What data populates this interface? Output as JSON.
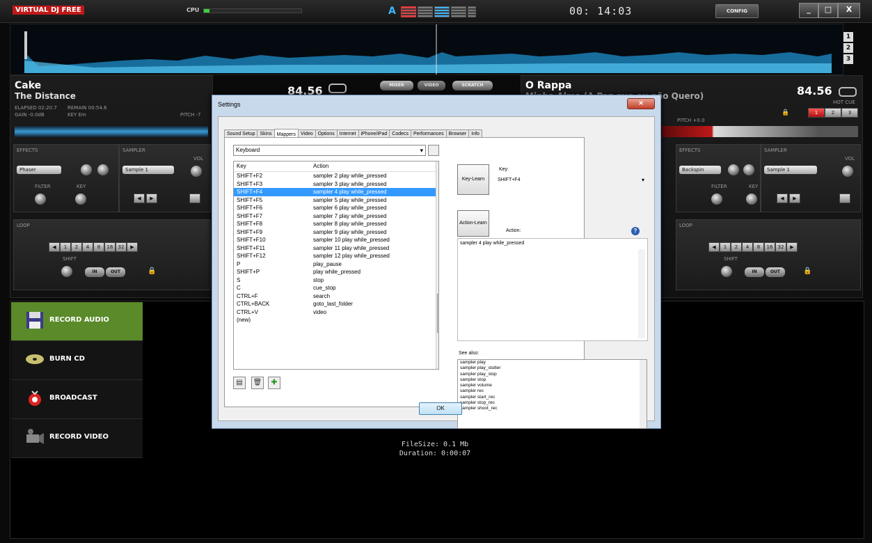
{
  "app": {
    "logo_prefix": "VIRTUAL",
    "logo_text": "DJ FREE",
    "cpu_label": "CPU",
    "cpu_level": 0.06,
    "view_a": "A",
    "clock": "00: 14:03",
    "config_label": "CONFIG",
    "window_buttons": [
      "_",
      "□",
      "X"
    ],
    "wave_buttons": [
      "1",
      "2",
      "3"
    ]
  },
  "deck_left": {
    "artist": "Cake",
    "title": "The Distance",
    "bpm": "84.56",
    "elapsed": "ELAPSED 02:20.7",
    "remain": "REMAIN 00:54.6",
    "gain": "GAIN -0.0dB",
    "key": "KEY Em",
    "pitch": "PITCH -7",
    "effects_label": "EFFECTS",
    "effect_value": "Phaser",
    "sampler_label": "SAMPLER",
    "sampler_value": "Sample 1",
    "filter_label": "FILTER",
    "key_label": "KEY",
    "vol_label": "VOL",
    "loop_label": "LOOP",
    "shift_label": "SHIFT",
    "in_label": "IN",
    "out_label": "OUT",
    "loop_values": [
      "1",
      "2",
      "4",
      "8",
      "16",
      "32"
    ]
  },
  "deck_right": {
    "artist": "O Rappa",
    "title": "Minha Alma (A Paz que eu não Quero)",
    "bpm": "84.56",
    "pitch": "PITCH +0.0",
    "hot_cue": "HOT CUE",
    "hot_cue_buttons": [
      "1",
      "2",
      "3"
    ],
    "effects_label": "EFFECTS",
    "effect_value": "Backspin",
    "sampler_label": "SAMPLER",
    "sampler_value": "Sample 1",
    "filter_label": "FILTER",
    "key_label": "KEY",
    "vol_label": "VOL",
    "loop_label": "LOOP",
    "shift_label": "SHIFT",
    "in_label": "IN",
    "out_label": "OUT",
    "loop_values": [
      "1",
      "2",
      "4",
      "8",
      "16",
      "32"
    ]
  },
  "center_tabs": [
    "MIXER",
    "VIDEO",
    "SCRATCH"
  ],
  "record_panel": {
    "items": [
      {
        "label": "RECORD AUDIO",
        "icon": "floppy-disk-icon"
      },
      {
        "label": "BURN CD",
        "icon": "cd-disc-icon"
      },
      {
        "label": "BROADCAST",
        "icon": "broadcast-icon"
      },
      {
        "label": "RECORD VIDEO",
        "icon": "video-camera-icon"
      }
    ],
    "file_size": "FileSize: 0.1 Mb",
    "duration": "Duration: 0:00:07"
  },
  "dialog": {
    "title": "Settings",
    "tabs": [
      "Sound Setup",
      "Skins",
      "Mappers",
      "Video",
      "Options",
      "Internet",
      "iPhone/iPad",
      "Codecs",
      "Performances",
      "Browser",
      "Info"
    ],
    "active_tab": "Mappers",
    "device_select": "Keyboard",
    "col_key": "Key",
    "col_action": "Action",
    "rows": [
      {
        "key": "SHIFT+F2",
        "action": "sampler 2 play while_pressed"
      },
      {
        "key": "SHIFT+F3",
        "action": "sampler 3 play while_pressed"
      },
      {
        "key": "SHIFT+F4",
        "action": "sampler 4 play while_pressed"
      },
      {
        "key": "SHIFT+F5",
        "action": "sampler 5 play while_pressed"
      },
      {
        "key": "SHIFT+F6",
        "action": "sampler 6 play while_pressed"
      },
      {
        "key": "SHIFT+F7",
        "action": "sampler 7 play while_pressed"
      },
      {
        "key": "SHIFT+F8",
        "action": "sampler 8 play while_pressed"
      },
      {
        "key": "SHIFT+F9",
        "action": "sampler 9 play while_pressed"
      },
      {
        "key": "SHIFT+F10",
        "action": "sampler 10 play while_pressed"
      },
      {
        "key": "SHIFT+F11",
        "action": "sampler 11 play while_pressed"
      },
      {
        "key": "SHIFT+F12",
        "action": "sampler 12 play while_pressed"
      },
      {
        "key": "P",
        "action": "play_pause"
      },
      {
        "key": "SHIFT+P",
        "action": "play while_pressed"
      },
      {
        "key": "S",
        "action": "stop"
      },
      {
        "key": "C",
        "action": "cue_stop"
      },
      {
        "key": "CTRL+F",
        "action": "search"
      },
      {
        "key": "CTRL+BACK",
        "action": "goto_last_folder"
      },
      {
        "key": "CTRL+V",
        "action": "video"
      },
      {
        "key": "(new)",
        "action": ""
      }
    ],
    "selected_row": 2,
    "key_learn": "Key-Learn",
    "key_label": "Key:",
    "key_value": "SHIFT+F4",
    "action_learn": "Action-Learn",
    "action_label": "Action:",
    "action_value": "sampler 4 play while_pressed",
    "see_also_label": "See also:",
    "see_also": [
      "sampler play",
      "sampler play_stutter",
      "sampler play_stop",
      "sampler stop",
      "sampler volume",
      "sampler rec",
      "sampler start_rec",
      "sampler stop_rec",
      "sampler shoot_rec"
    ],
    "ok_label": "OK"
  }
}
